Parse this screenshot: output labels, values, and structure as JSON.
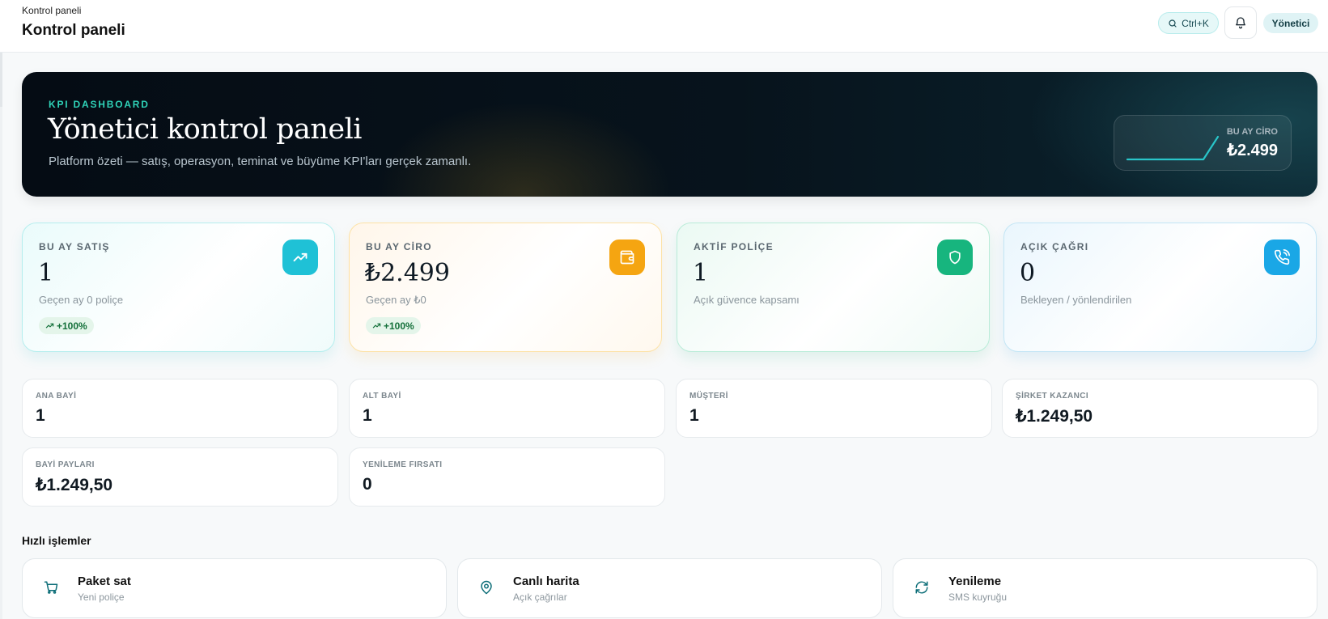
{
  "header": {
    "breadcrumb": "Kontrol paneli",
    "title": "Kontrol paneli",
    "search_shortcut": "Ctrl+K",
    "role_badge": "Yönetici"
  },
  "hero": {
    "eyebrow": "KPI DASHBOARD",
    "title": "Yönetici kontrol paneli",
    "subtitle": "Platform özeti — satış, operasyon, teminat ve büyüme KPI'ları gerçek zamanlı.",
    "mini_label": "BU AY CİRO",
    "mini_value": "₺2.499"
  },
  "kpis": [
    {
      "label": "BU AY SATIŞ",
      "value": "1",
      "sub": "Geçen ay 0 poliçe",
      "trend": "+100%",
      "icon": "trending-up-icon",
      "color": "#1fc1d6"
    },
    {
      "label": "BU AY CİRO",
      "value": "₺2.499",
      "sub": "Geçen ay ₺0",
      "trend": "+100%",
      "icon": "wallet-icon",
      "color": "#f5a511"
    },
    {
      "label": "AKTİF POLİÇE",
      "value": "1",
      "sub": "Açık güvence kapsamı",
      "icon": "shield-icon",
      "color": "#17b57e"
    },
    {
      "label": "AÇIK ÇAĞRI",
      "value": "0",
      "sub": "Bekleyen / yönlendirilen",
      "icon": "phone-call-icon",
      "color": "#1aa7e6"
    }
  ],
  "stats": [
    {
      "label": "ANA BAYİ",
      "value": "1"
    },
    {
      "label": "ALT BAYİ",
      "value": "1"
    },
    {
      "label": "MÜŞTERİ",
      "value": "1"
    },
    {
      "label": "ŞİRKET KAZANCI",
      "value": "₺1.249,50"
    },
    {
      "label": "BAYİ PAYLARI",
      "value": "₺1.249,50"
    },
    {
      "label": "YENİLEME FIRSATI",
      "value": "0"
    }
  ],
  "quick_actions": {
    "title": "Hızlı işlemler",
    "items": [
      {
        "title": "Paket sat",
        "sub": "Yeni poliçe",
        "icon": "cart-icon"
      },
      {
        "title": "Canlı harita",
        "sub": "Açık çağrılar",
        "icon": "map-pin-icon"
      },
      {
        "title": "Yenileme",
        "sub": "SMS kuyruğu",
        "icon": "refresh-icon"
      }
    ]
  }
}
